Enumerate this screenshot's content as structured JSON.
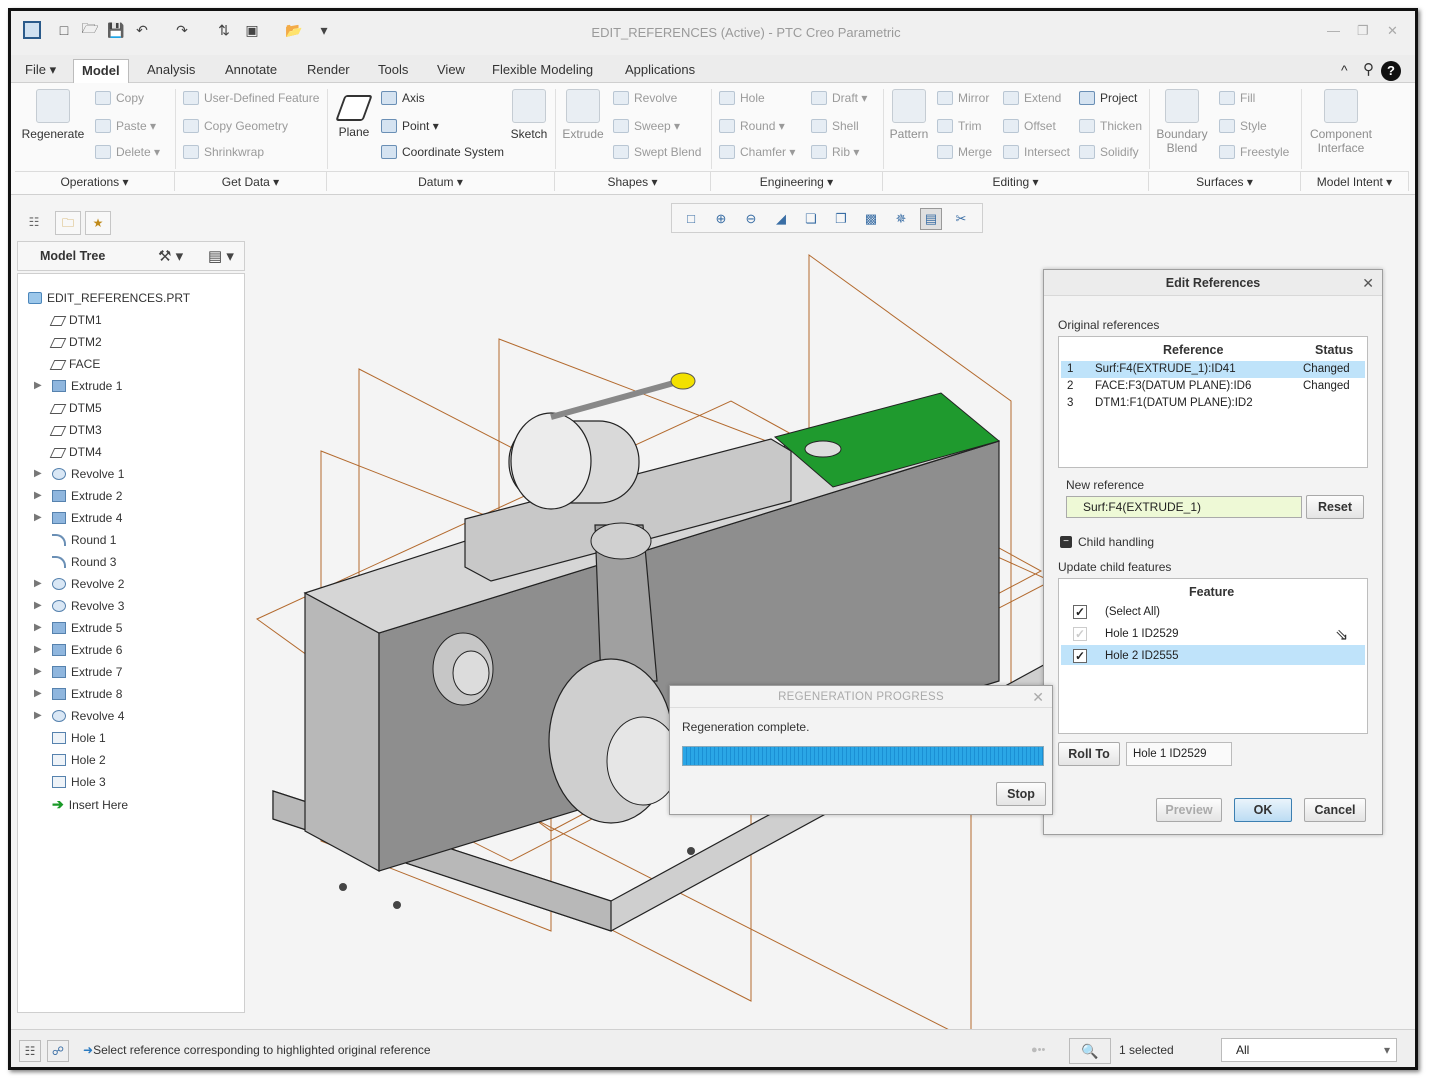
{
  "window": {
    "title": "EDIT_REFERENCES (Active) - PTC Creo Parametric"
  },
  "menu": {
    "file": "File",
    "tabs": [
      "Model",
      "Analysis",
      "Annotate",
      "Render",
      "Tools",
      "View",
      "Flexible Modeling",
      "Applications"
    ]
  },
  "ribbon": {
    "regenerate": "Regenerate",
    "operations": [
      "Copy",
      "Paste",
      "Delete"
    ],
    "getdata": [
      "User-Defined Feature",
      "Copy Geometry",
      "Shrinkwrap"
    ],
    "plane": "Plane",
    "datum": [
      "Axis",
      "Point",
      "Coordinate System"
    ],
    "sketch": "Sketch",
    "extrude": "Extrude",
    "shapes": [
      "Revolve",
      "Sweep",
      "Swept Blend"
    ],
    "engineering": [
      "Hole",
      "Round",
      "Chamfer",
      "Draft",
      "Shell",
      "Rib"
    ],
    "pattern": "Pattern",
    "editing": [
      "Mirror",
      "Trim",
      "Merge",
      "Extend",
      "Offset",
      "Intersect",
      "Project",
      "Thicken",
      "Solidify"
    ],
    "boundary": "Boundary\nBlend",
    "surfaces": [
      "Fill",
      "Style",
      "Freestyle"
    ],
    "component": "Component\nInterface",
    "groups": [
      "Operations",
      "Get Data",
      "Datum",
      "Shapes",
      "Engineering",
      "Editing",
      "Surfaces",
      "Model Intent"
    ]
  },
  "tree": {
    "title": "Model Tree",
    "items": [
      {
        "label": "EDIT_REFERENCES.PRT",
        "icon": "prt",
        "level": 0,
        "exp": false
      },
      {
        "label": "DTM1",
        "icon": "plane",
        "level": 1,
        "exp": false
      },
      {
        "label": "DTM2",
        "icon": "plane",
        "level": 1,
        "exp": false
      },
      {
        "label": "FACE",
        "icon": "plane",
        "level": 1,
        "exp": false
      },
      {
        "label": "Extrude 1",
        "icon": "ext",
        "level": 1,
        "exp": true
      },
      {
        "label": "DTM5",
        "icon": "plane",
        "level": 1,
        "exp": false
      },
      {
        "label": "DTM3",
        "icon": "plane",
        "level": 1,
        "exp": false
      },
      {
        "label": "DTM4",
        "icon": "plane",
        "level": 1,
        "exp": false
      },
      {
        "label": "Revolve 1",
        "icon": "rev",
        "level": 1,
        "exp": true
      },
      {
        "label": "Extrude 2",
        "icon": "ext",
        "level": 1,
        "exp": true
      },
      {
        "label": "Extrude 4",
        "icon": "ext",
        "level": 1,
        "exp": true
      },
      {
        "label": "Round 1",
        "icon": "rnd",
        "level": 1,
        "exp": false
      },
      {
        "label": "Round 3",
        "icon": "rnd",
        "level": 1,
        "exp": false
      },
      {
        "label": "Revolve 2",
        "icon": "rev",
        "level": 1,
        "exp": true
      },
      {
        "label": "Revolve 3",
        "icon": "rev",
        "level": 1,
        "exp": true
      },
      {
        "label": "Extrude 5",
        "icon": "ext",
        "level": 1,
        "exp": true
      },
      {
        "label": "Extrude 6",
        "icon": "ext",
        "level": 1,
        "exp": true
      },
      {
        "label": "Extrude 7",
        "icon": "ext",
        "level": 1,
        "exp": true
      },
      {
        "label": "Extrude 8",
        "icon": "ext",
        "level": 1,
        "exp": true
      },
      {
        "label": "Revolve 4",
        "icon": "rev",
        "level": 1,
        "exp": true
      },
      {
        "label": "Hole 1",
        "icon": "hole",
        "level": 1,
        "exp": false
      },
      {
        "label": "Hole 2",
        "icon": "hole",
        "level": 1,
        "exp": false
      },
      {
        "label": "Hole 3",
        "icon": "hole",
        "level": 1,
        "exp": false
      },
      {
        "label": "Insert Here",
        "icon": "ins",
        "level": 1,
        "exp": false
      }
    ]
  },
  "editref": {
    "title": "Edit References",
    "original_label": "Original references",
    "col_ref": "Reference",
    "col_status": "Status",
    "rows": [
      {
        "n": "1",
        "ref": "Surf:F4(EXTRUDE_1):ID41",
        "status": "Changed"
      },
      {
        "n": "2",
        "ref": "FACE:F3(DATUM PLANE):ID6",
        "status": "Changed"
      },
      {
        "n": "3",
        "ref": "DTM1:F1(DATUM PLANE):ID2",
        "status": ""
      }
    ],
    "new_label": "New reference",
    "new_value": "Surf:F4(EXTRUDE_1)",
    "reset": "Reset",
    "child_handling": "Child handling",
    "update_label": "Update child features",
    "col_feature": "Feature",
    "features": [
      "(Select All)",
      "Hole 1 ID2529",
      "Hole 2 ID2555"
    ],
    "rollto": "Roll To",
    "rollto_value": "Hole 1 ID2529",
    "preview": "Preview",
    "ok": "OK",
    "cancel": "Cancel"
  },
  "regen": {
    "title": "REGENERATION PROGRESS",
    "message": "Regeneration complete.",
    "stop": "Stop",
    "progress": 1.0
  },
  "status": {
    "message": "Select reference corresponding to highlighted original reference",
    "selected": "1 selected",
    "filter": "All"
  },
  "colors": {
    "accent": "#1b8fd4",
    "selection": "#bfe3fa",
    "highlight_face": "#1f9a2e",
    "handle": "#f2e100"
  }
}
